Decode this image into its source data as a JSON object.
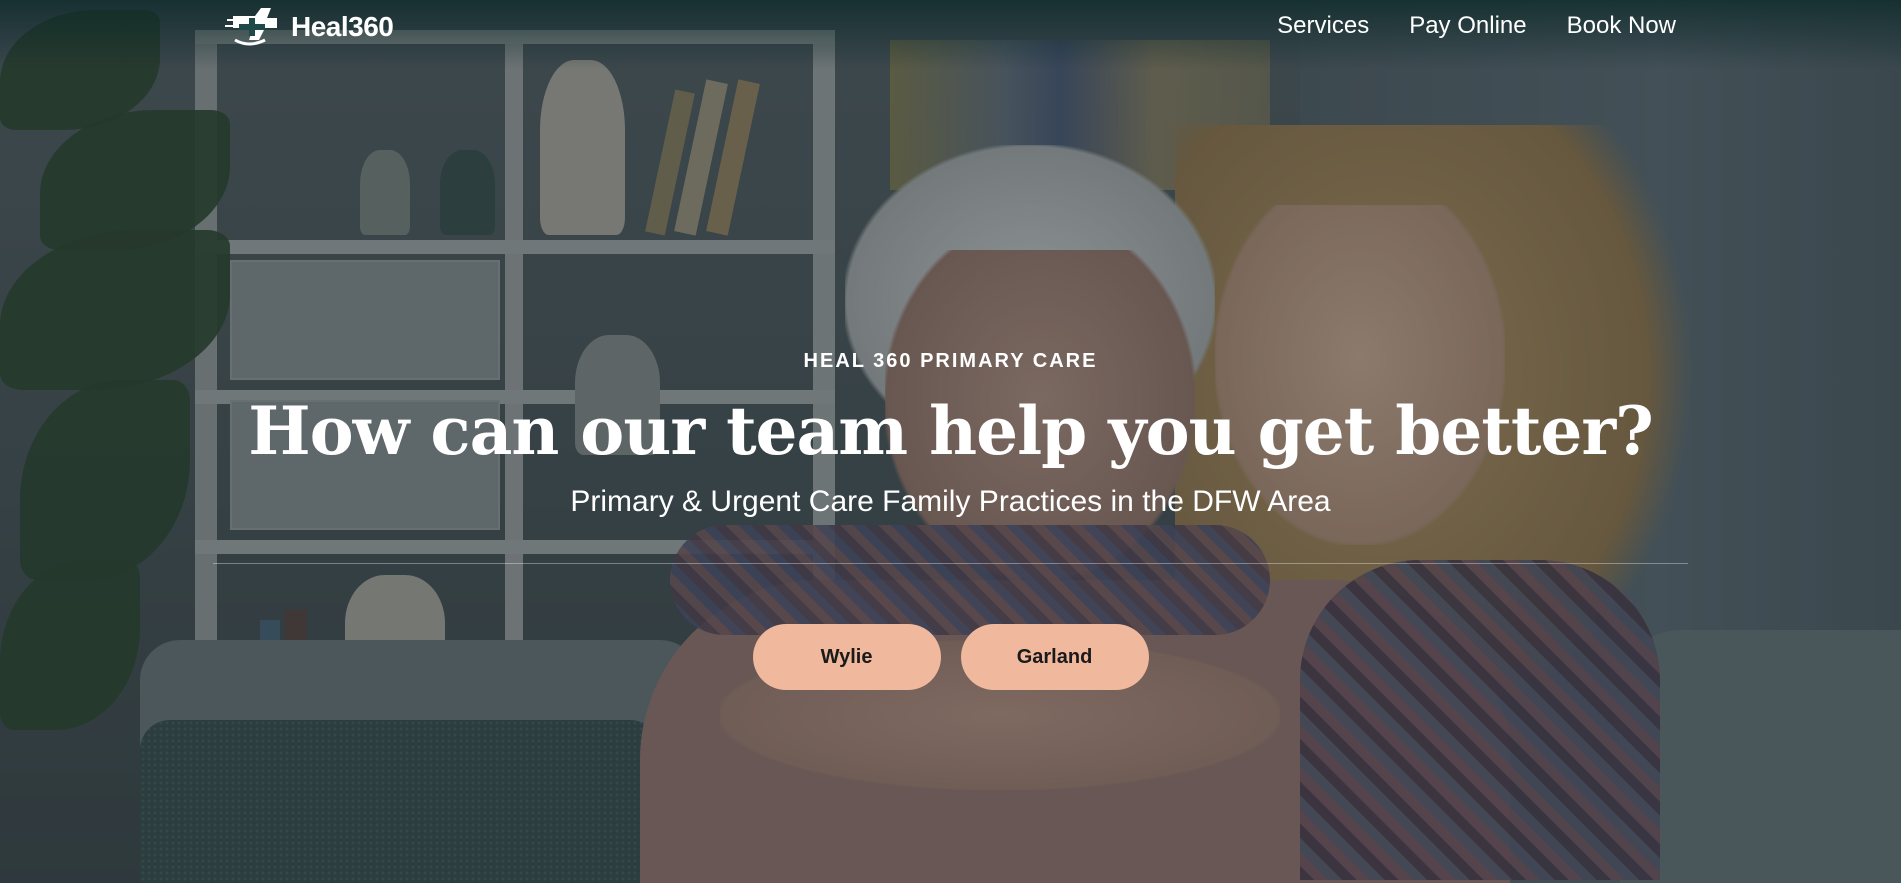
{
  "header": {
    "logo_text": "Heal360",
    "nav": [
      "Services",
      "Pay Online",
      "Book Now"
    ]
  },
  "hero": {
    "eyebrow": "HEAL 360 PRIMARY CARE",
    "headline": "How can our team help you get better?",
    "subhead": "Primary & Urgent Care Family Practices in the DFW Area",
    "locations": [
      "Wylie",
      "Garland"
    ]
  },
  "colors": {
    "button_bg": "#f0b89d",
    "button_text": "#1a1a1a",
    "text": "#ffffff"
  }
}
